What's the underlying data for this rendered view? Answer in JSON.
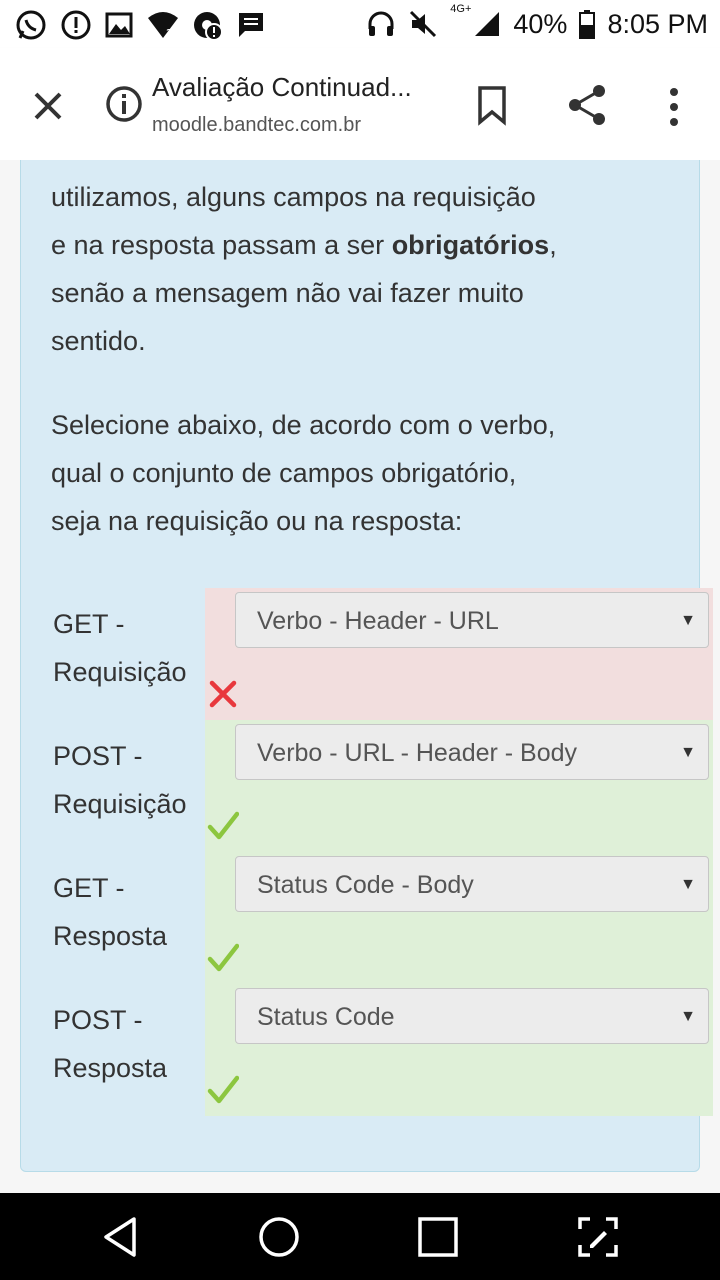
{
  "status_bar": {
    "network": "4G+",
    "battery": "40%",
    "time": "8:05 PM",
    "icons_left": [
      "whatsapp-icon",
      "alert-icon",
      "image-icon",
      "wifi-icon",
      "chrome-alert-icon",
      "message-icon"
    ],
    "icons_right": [
      "headset-icon",
      "mute-icon",
      "signal-icon",
      "battery-icon"
    ]
  },
  "toolbar": {
    "title": "Avaliação Continuad...",
    "url": "moodle.bandtec.com.br"
  },
  "content": {
    "para1_line1": "utilizamos, alguns campos na requisição",
    "para1_line2_pre": "e na resposta passam a ser ",
    "para1_line2_bold": "obrigatórios",
    "para1_line2_post": ",",
    "para1_line3": "senão a mensagem não vai fazer muito",
    "para1_line4": "sentido.",
    "para2_line1": "Selecione abaixo, de acordo com o verbo,",
    "para2_line2": "qual o conjunto de campos obrigatório,",
    "para2_line3": "seja na requisição ou na resposta:"
  },
  "rows": [
    {
      "label_line1": "GET -",
      "label_line2": "Requisição",
      "selected": "Verbo - Header - URL",
      "correct": false
    },
    {
      "label_line1": "POST -",
      "label_line2": "Requisição",
      "selected": "Verbo - URL - Header - Body",
      "correct": true
    },
    {
      "label_line1": "GET -",
      "label_line2": "Resposta",
      "selected": "Status Code - Body",
      "correct": true
    },
    {
      "label_line1": "POST -",
      "label_line2": "Resposta",
      "selected": "Status Code",
      "correct": true
    }
  ],
  "colors": {
    "card_bg": "#d9ebf5",
    "incorrect_bg": "#f2dede",
    "correct_bg": "#dff0d8",
    "check_color": "#8cc63f",
    "cross_color": "#e8383d"
  }
}
